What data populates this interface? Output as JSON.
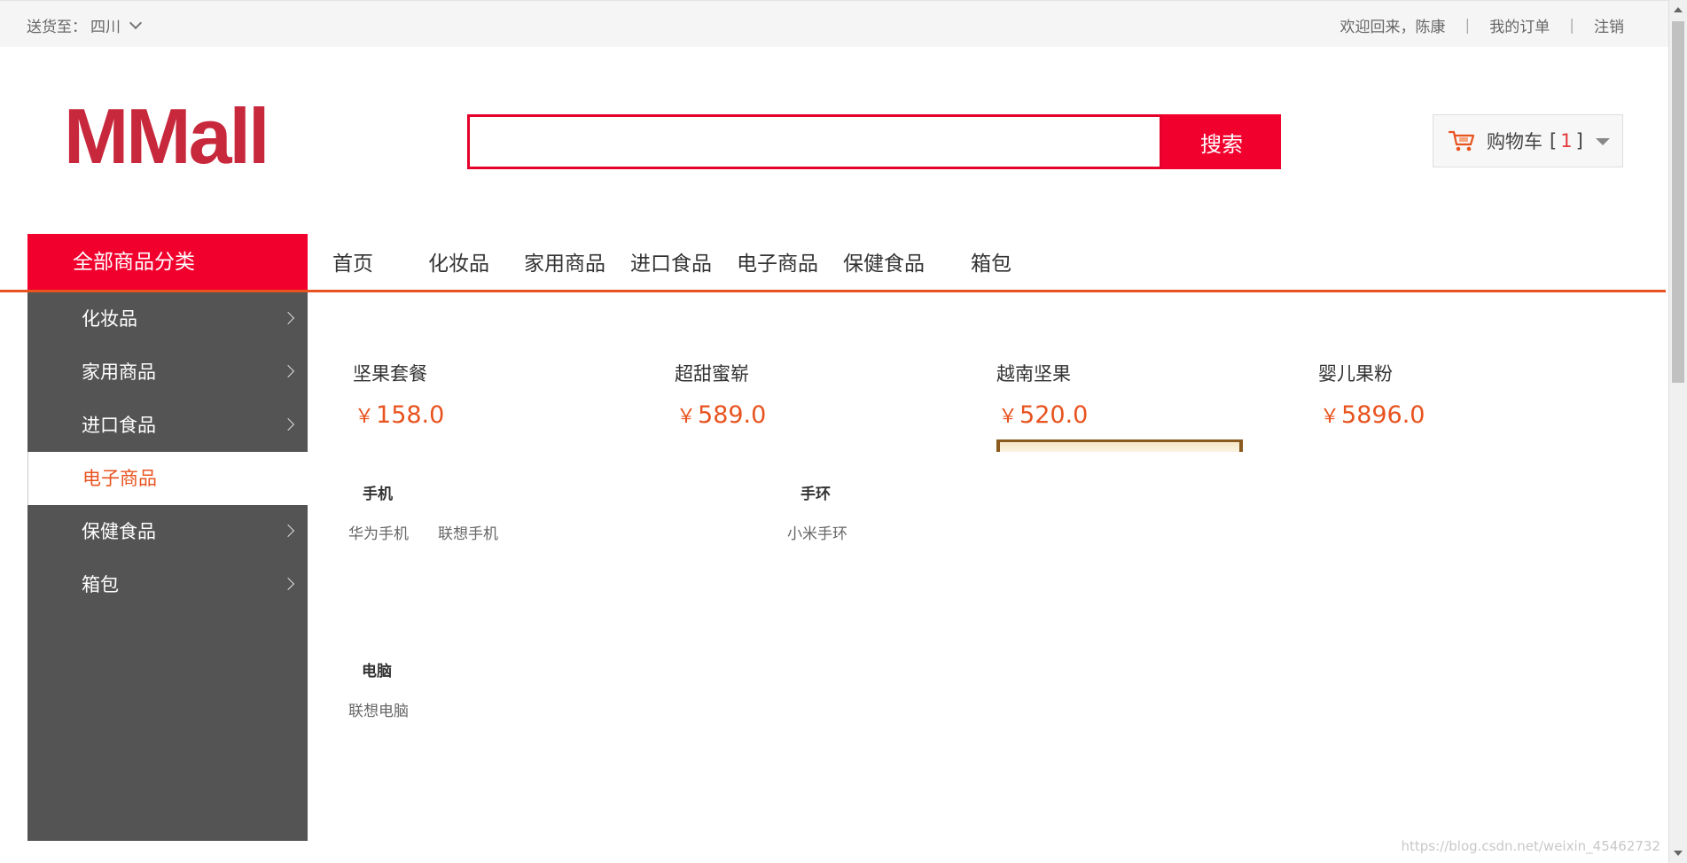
{
  "topbar": {
    "location_prefix": "送货至：",
    "location": "四川",
    "welcome": "欢迎回来，陈康",
    "separator": "|",
    "orders": "我的订单",
    "logout": "注销"
  },
  "logo": {
    "text": "MMall"
  },
  "search": {
    "value": "",
    "button": "搜索"
  },
  "cart": {
    "label": "购物车",
    "open": "[",
    "count": "1",
    "close": "]"
  },
  "nav": {
    "all_label": "全部商品分类",
    "links": [
      "首页",
      "化妆品",
      "家用商品",
      "进口食品",
      "电子商品",
      "保健食品",
      "箱包"
    ]
  },
  "sidebar": {
    "items": [
      {
        "label": "化妆品"
      },
      {
        "label": "家用商品"
      },
      {
        "label": "进口食品"
      },
      {
        "label": "电子商品",
        "active": true
      },
      {
        "label": "保健食品"
      },
      {
        "label": "箱包"
      }
    ]
  },
  "products": [
    {
      "name": "坚果套餐",
      "currency": "￥",
      "price": "158.0"
    },
    {
      "name": "超甜蜜崭",
      "currency": "￥",
      "price": "589.0"
    },
    {
      "name": "越南坚果",
      "currency": "￥",
      "price": "520.0"
    },
    {
      "name": "婴儿果粉",
      "currency": "￥",
      "price": "5896.0"
    }
  ],
  "subcategories": [
    {
      "title": "手机",
      "links": [
        "华为手机",
        "联想手机"
      ]
    },
    {
      "title": "手环",
      "links": [
        "小米手环"
      ]
    },
    {
      "title": "电脑",
      "links": [
        "联想电脑"
      ]
    }
  ],
  "watermark": "https://blog.csdn.net/weixin_45462732",
  "colors": {
    "accent": "#f1002d",
    "orange": "#e8531f",
    "sidebar": "#545454",
    "logo": "#c8283c"
  }
}
